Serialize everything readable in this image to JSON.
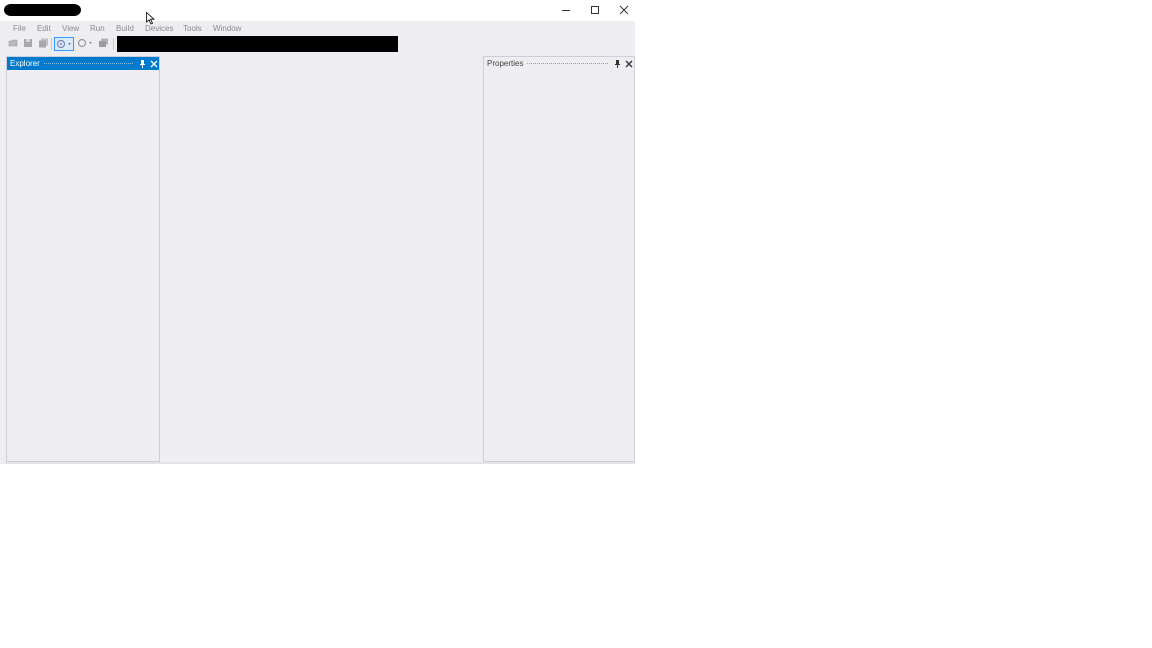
{
  "window": {
    "controls": {
      "minimize": "minimize-icon",
      "maximize": "maximize-icon",
      "close": "close-icon"
    }
  },
  "menubar": {
    "items": [
      "File",
      "Edit",
      "View",
      "Run",
      "Build",
      "Devices",
      "Tools",
      "Window"
    ]
  },
  "toolbar": {
    "icons": [
      "open-file-icon",
      "save-icon",
      "save-all-icon",
      "build-target-icon",
      "configuration-icon",
      "deploy-icon"
    ]
  },
  "panels": {
    "explorer": {
      "title": "Explorer"
    },
    "properties": {
      "title": "Properties"
    }
  },
  "colors": {
    "accent": "#007acc",
    "panel_bg": "#eeeef2",
    "menu_text": "#8a8a8a"
  }
}
